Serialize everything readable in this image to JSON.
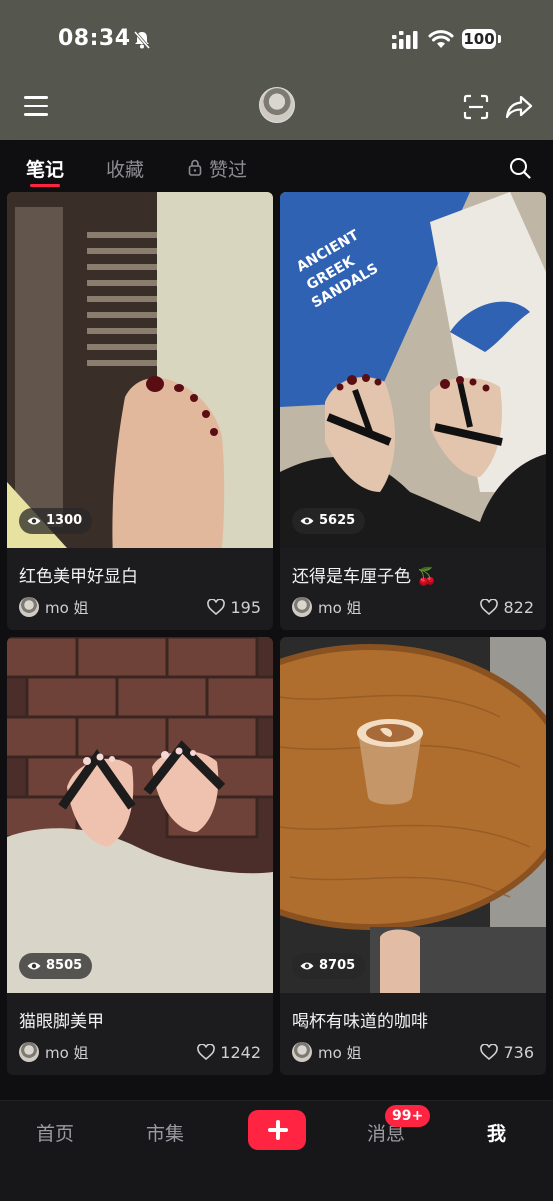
{
  "status_bar": {
    "time": "08:34",
    "battery": "100"
  },
  "icons": {
    "menu": "menu-icon",
    "scan": "scan-icon",
    "share": "share-icon",
    "search": "search-icon",
    "lock": "lock-icon",
    "eye": "eye-icon",
    "heart": "heart-icon"
  },
  "tabs": [
    {
      "label": "笔记",
      "active": true
    },
    {
      "label": "收藏",
      "active": false
    },
    {
      "label": "赞过",
      "active": false,
      "locked": true
    }
  ],
  "posts": [
    {
      "title": "红色美甲好显白",
      "views": "1300",
      "author": "mo 姐",
      "likes": "195"
    },
    {
      "title": "还得是车厘子色 🍒",
      "views": "5625",
      "author": "mo 姐",
      "likes": "822"
    },
    {
      "title": "猫眼脚美甲",
      "views": "8505",
      "author": "mo 姐",
      "likes": "1242"
    },
    {
      "title": "喝杯有味道的咖啡",
      "views": "8705",
      "author": "mo 姐",
      "likes": "736"
    }
  ],
  "bottom_nav": {
    "home": "首页",
    "market": "市集",
    "messages": "消息",
    "messages_badge": "99+",
    "me": "我"
  },
  "colors": {
    "accent": "#ff2442",
    "background": "#0f0f11",
    "header": "#55574f",
    "card": "#1c1c1f"
  }
}
